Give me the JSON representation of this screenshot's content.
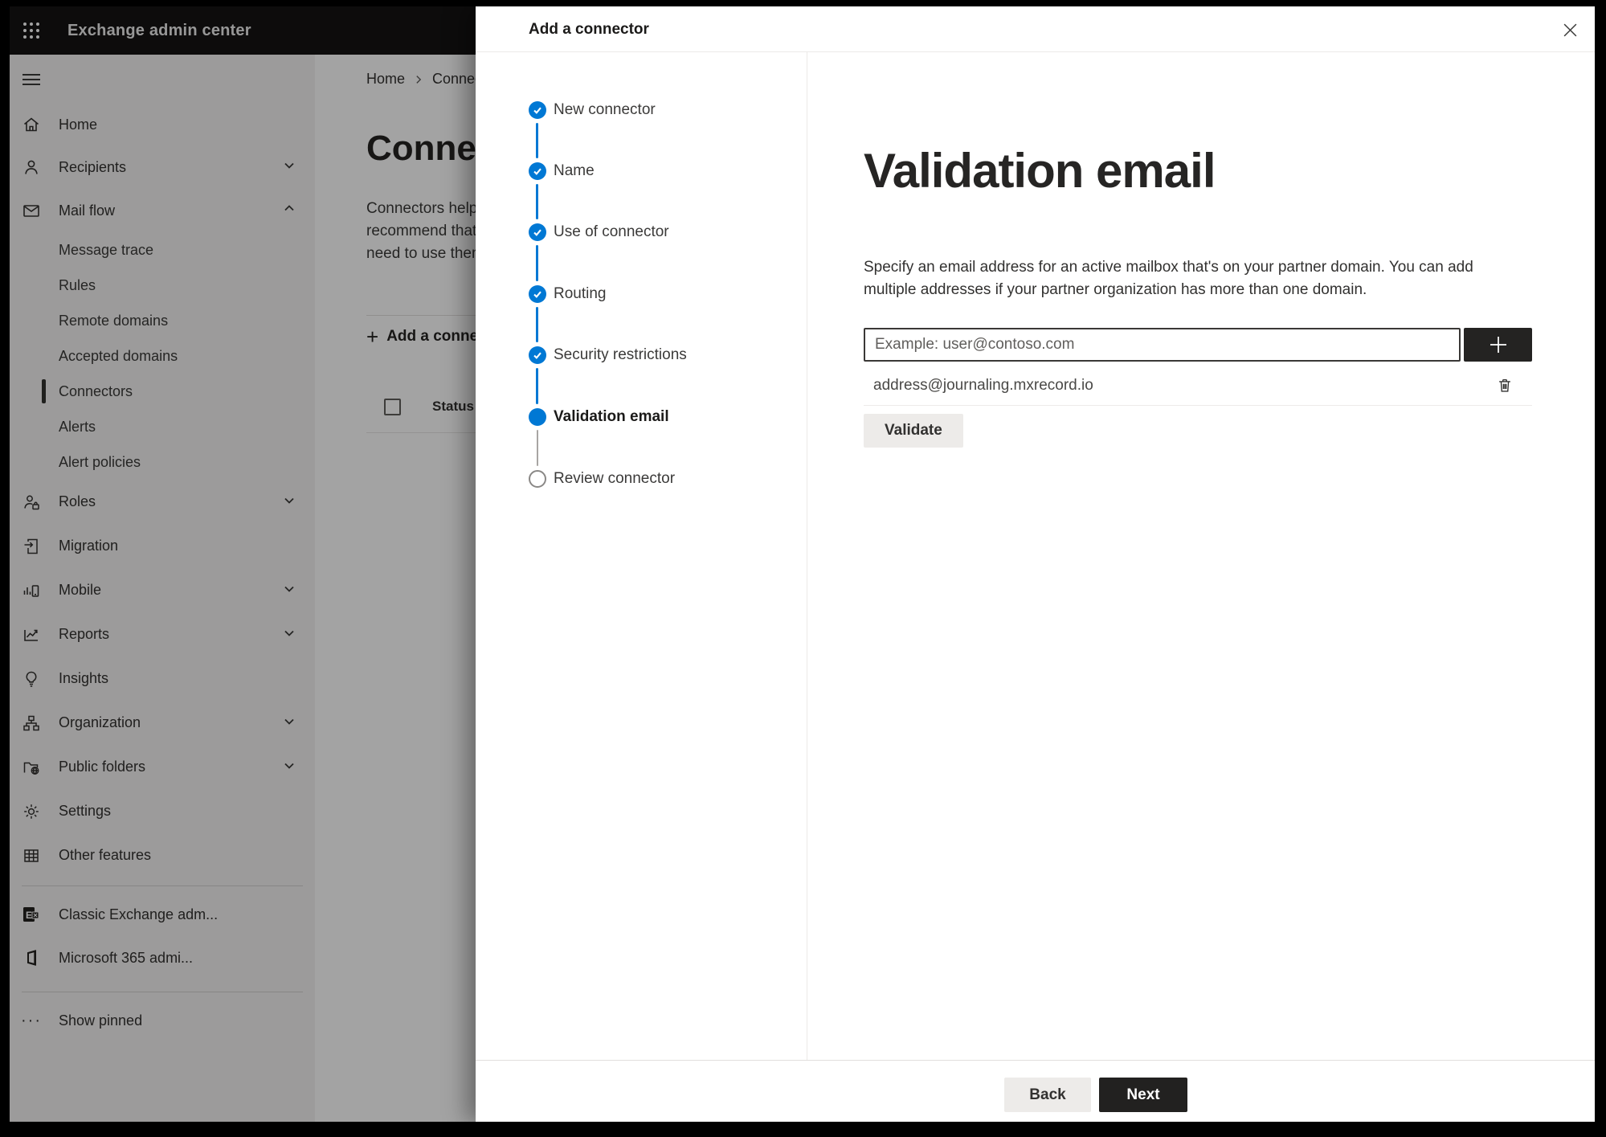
{
  "topbar": {
    "title": "Exchange admin center"
  },
  "sidebar": {
    "items": [
      {
        "label": "Home"
      },
      {
        "label": "Recipients",
        "chevron": "down"
      },
      {
        "label": "Mail flow",
        "chevron": "up",
        "expanded": true
      },
      {
        "label": "Message trace"
      },
      {
        "label": "Rules"
      },
      {
        "label": "Remote domains"
      },
      {
        "label": "Accepted domains"
      },
      {
        "label": "Connectors",
        "selected": true
      },
      {
        "label": "Alerts"
      },
      {
        "label": "Alert policies"
      },
      {
        "label": "Roles",
        "chevron": "down"
      },
      {
        "label": "Migration"
      },
      {
        "label": "Mobile",
        "chevron": "down"
      },
      {
        "label": "Reports",
        "chevron": "down"
      },
      {
        "label": "Insights"
      },
      {
        "label": "Organization",
        "chevron": "down"
      },
      {
        "label": "Public folders",
        "chevron": "down"
      },
      {
        "label": "Settings"
      },
      {
        "label": "Other features"
      }
    ],
    "footer_items": [
      {
        "label": "Classic Exchange adm..."
      },
      {
        "label": "Microsoft 365 admi..."
      },
      {
        "label": "Show pinned"
      }
    ]
  },
  "connectors_page": {
    "breadcrumb": [
      "Home",
      "Connectors"
    ],
    "title": "Connectors",
    "description_lines": [
      "Connectors help",
      "recommend that",
      "need to use them"
    ],
    "add_button": "Add a connector",
    "table": {
      "header": "Status"
    }
  },
  "wizard": {
    "title": "Add a connector",
    "steps": [
      {
        "label": "New connector",
        "state": "completed"
      },
      {
        "label": "Name",
        "state": "completed"
      },
      {
        "label": "Use of connector",
        "state": "completed"
      },
      {
        "label": "Routing",
        "state": "completed"
      },
      {
        "label": "Security restrictions",
        "state": "completed"
      },
      {
        "label": "Validation email",
        "state": "current"
      },
      {
        "label": "Review connector",
        "state": "upcoming"
      }
    ],
    "content": {
      "heading": "Validation email",
      "description": "Specify an email address for an active mailbox that's on your partner domain. You can add multiple addresses if your partner organization has more than one domain.",
      "email_input": {
        "value": "",
        "placeholder": "Example: user@contoso.com"
      },
      "addresses": [
        {
          "email": "address@journaling.mxrecord.io"
        }
      ],
      "validate_button": "Validate"
    },
    "footer": {
      "back_button": "Back",
      "next_button": "Next"
    }
  },
  "colors": {
    "accent_blue": "#0078d4",
    "topbar_bg": "#151413",
    "overlay": "rgba(0,0,0,0.36)"
  }
}
